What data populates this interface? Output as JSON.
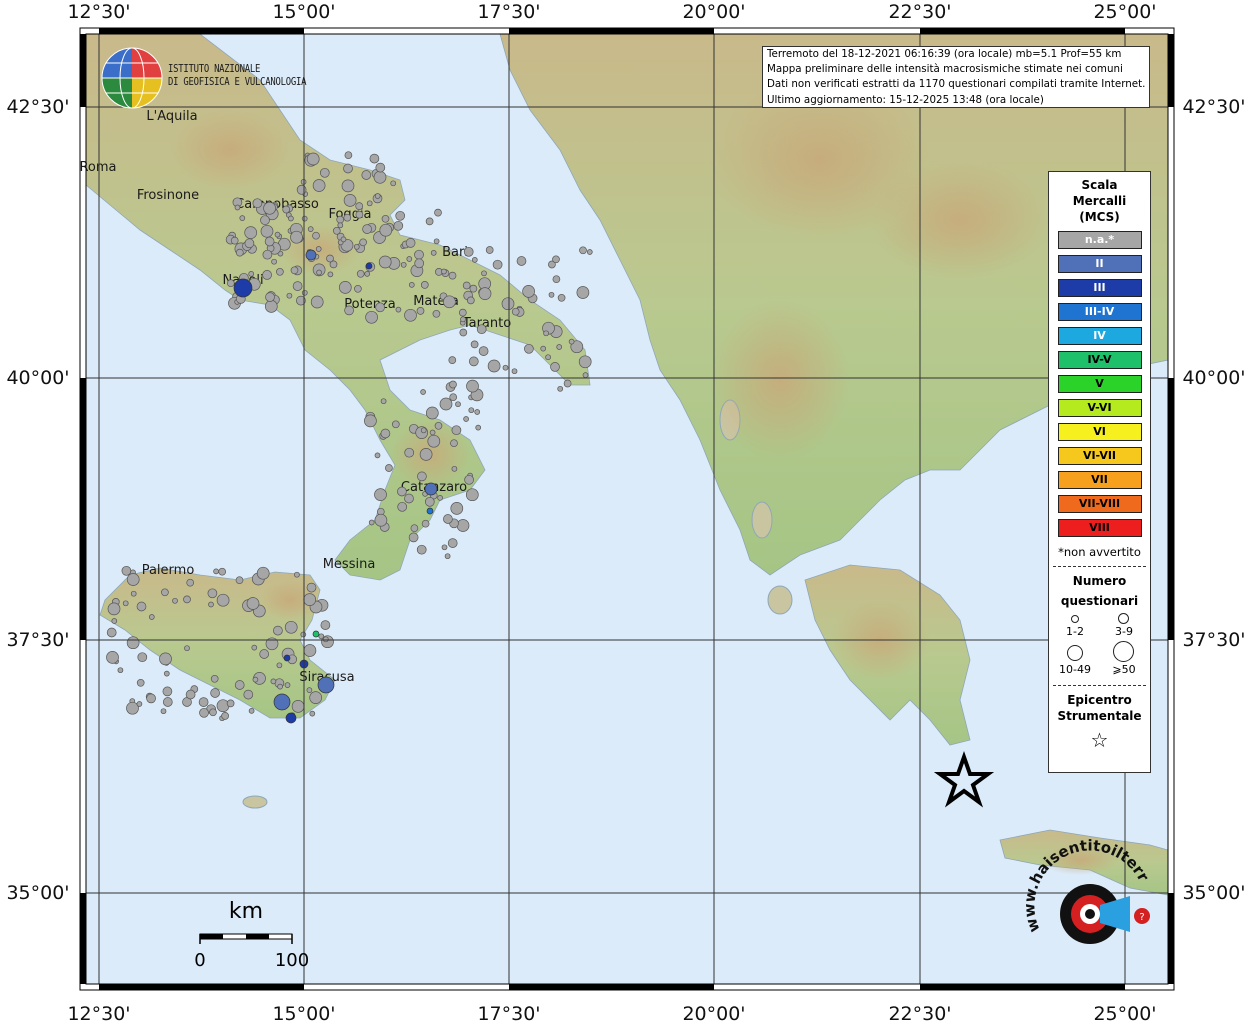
{
  "header_info": {
    "line1": "Terremoto del 18-12-2021 06:16:39 (ora locale) mb=5.1 Prof=55 km",
    "line2": "Mappa preliminare delle intensità macrosismiche stimate nei comuni",
    "line3": "Dati non verificati estratti da 1170 questionari compilati tramite Internet.",
    "line4": "Ultimo aggiornamento: 15-12-2025 13:48 (ora locale)"
  },
  "logo": {
    "line1": "ISTITUTO NAZIONALE",
    "line2": "DI GEOFISICA E VULCANOLOGIA"
  },
  "axes": {
    "top_ticks": [
      "12°30'",
      "15°00'",
      "17°30'",
      "20°00'",
      "22°30'",
      "25°00'"
    ],
    "bottom_ticks": [
      "12°30'",
      "15°00'",
      "17°30'",
      "20°00'",
      "22°30'",
      "25°00'"
    ],
    "left_ticks": [
      "42°30'",
      "40°00'",
      "37°30'",
      "35°00'"
    ],
    "right_ticks": [
      "42°30'",
      "40°00'",
      "37°30'",
      "35°00'"
    ]
  },
  "cities": [
    {
      "name": "L'Aquila"
    },
    {
      "name": "Roma"
    },
    {
      "name": "Frosinone"
    },
    {
      "name": "Campobasso"
    },
    {
      "name": "Foggia"
    },
    {
      "name": "Bari"
    },
    {
      "name": "Napoli"
    },
    {
      "name": "Potenza"
    },
    {
      "name": "Matera"
    },
    {
      "name": "Taranto"
    },
    {
      "name": "Catanzaro"
    },
    {
      "name": "Palermo"
    },
    {
      "name": "Messina"
    },
    {
      "name": "Siracusa"
    }
  ],
  "scale_bar": {
    "unit": "km",
    "min": "0",
    "max": "100"
  },
  "legend": {
    "title": "Scala Mercalli (MCS)",
    "title_line1": "Scala",
    "title_line2": "Mercalli",
    "title_line3": "(MCS)",
    "classes": [
      {
        "label": "n.a.*",
        "color": "#a6a6a6",
        "text_color": "#ffffff"
      },
      {
        "label": "II",
        "color": "#5070b8",
        "text_color": "#ffffff"
      },
      {
        "label": "III",
        "color": "#1e3ca8",
        "text_color": "#ffffff"
      },
      {
        "label": "III-IV",
        "color": "#1e74d0",
        "text_color": "#ffffff"
      },
      {
        "label": "IV",
        "color": "#1ea8e0",
        "text_color": "#ffffff"
      },
      {
        "label": "IV-V",
        "color": "#1ec06a",
        "text_color": "#000000"
      },
      {
        "label": "V",
        "color": "#2ad22a",
        "text_color": "#000000"
      },
      {
        "label": "V-VI",
        "color": "#b4ea1e",
        "text_color": "#000000"
      },
      {
        "label": "VI",
        "color": "#f6f01e",
        "text_color": "#000000"
      },
      {
        "label": "VI-VII",
        "color": "#f6c81e",
        "text_color": "#000000"
      },
      {
        "label": "VII",
        "color": "#f6a01e",
        "text_color": "#000000"
      },
      {
        "label": "VII-VIII",
        "color": "#f06a1e",
        "text_color": "#000000"
      },
      {
        "label": "VIII",
        "color": "#ec1e1e",
        "text_color": "#000000"
      }
    ],
    "note": "*non avvertito",
    "count_title_line1": "Numero",
    "count_title_line2": "questionari",
    "count_sizes": [
      "1-2",
      "3-9",
      "10-49",
      "⩾50"
    ],
    "epicenter_line1": "Epicentro",
    "epicenter_line2": "Strumentale",
    "epicenter_symbol": "☆"
  },
  "brand": {
    "text": "www.haisentitoilterremoto.it"
  },
  "colors": {
    "sea": "#dcecfb",
    "land": "#d9cfa4",
    "land_green": "#a9c98a",
    "grid": "#333333",
    "frame": "#000000"
  }
}
